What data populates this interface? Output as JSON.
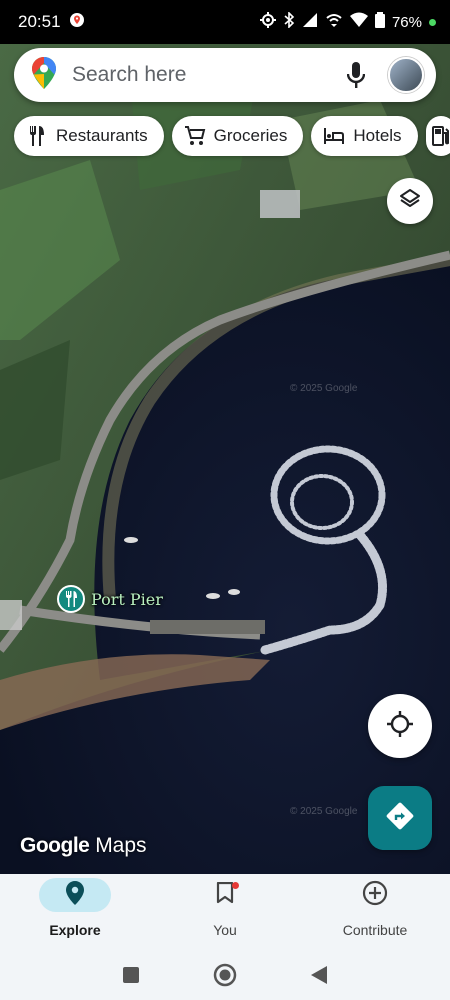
{
  "status_bar": {
    "time": "20:51",
    "battery": "76%",
    "icons": [
      "maps-notification-icon",
      "location-icon",
      "bluetooth-icon",
      "signal-icon",
      "hotspot-icon",
      "wifi-icon",
      "battery-icon"
    ]
  },
  "search": {
    "placeholder": "Search here",
    "logo_icon": "maps-pin-logo-icon",
    "mic_icon": "mic-icon"
  },
  "chips": [
    {
      "label": "Restaurants",
      "icon": "fork-knife-icon"
    },
    {
      "label": "Groceries",
      "icon": "cart-icon"
    },
    {
      "label": "Hotels",
      "icon": "bed-icon"
    },
    {
      "label": "",
      "icon": "gas-station-icon"
    }
  ],
  "map": {
    "place_name": "Port Pier",
    "place_icon": "restaurant-pin-icon",
    "watermark_google": "Google",
    "watermark_maps": "Maps",
    "copyright": "© 2025 Google"
  },
  "controls": {
    "layers_icon": "layers-icon",
    "locate_icon": "my-location-icon",
    "directions_icon": "directions-icon"
  },
  "bottom_nav": [
    {
      "label": "Explore",
      "icon": "explore-pin-icon",
      "active": true
    },
    {
      "label": "You",
      "icon": "bookmark-icon",
      "active": false
    },
    {
      "label": "Contribute",
      "icon": "add-circle-icon",
      "active": false
    }
  ],
  "system_nav": [
    "recents-icon",
    "home-icon",
    "back-icon"
  ],
  "colors": {
    "accent_teal": "#0b7c85",
    "explore_pill": "#c5e9f3",
    "place_label": "#b9f0bf"
  }
}
